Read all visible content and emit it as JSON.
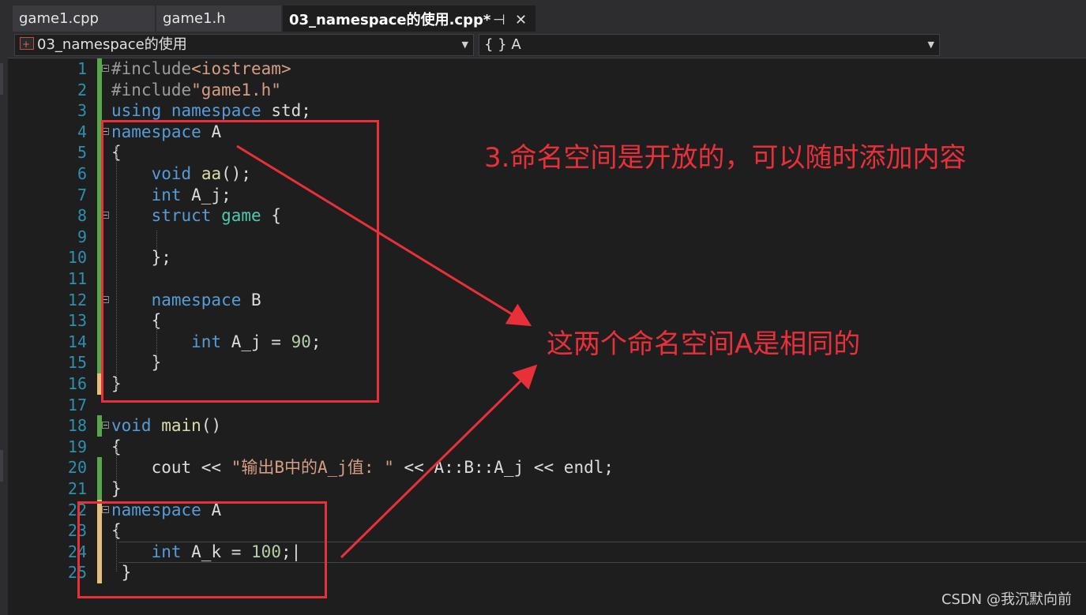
{
  "tabs": [
    {
      "label": "game1.cpp",
      "active": false
    },
    {
      "label": "game1.h",
      "active": false
    },
    {
      "label": "03_namespace的使用.cpp*",
      "active": true
    }
  ],
  "tab_icons": {
    "pin": "⊣",
    "close": "✕"
  },
  "nav": {
    "scope": "03_namespace的使用",
    "member": "{ } A"
  },
  "code_lines": [
    {
      "n": "1",
      "segments": [
        [
          "pp",
          "#include"
        ],
        [
          "str",
          "<iostream>"
        ]
      ]
    },
    {
      "n": "2",
      "segments": [
        [
          "pp",
          "#include"
        ],
        [
          "str",
          "\"game1.h\""
        ]
      ]
    },
    {
      "n": "3",
      "segments": [
        [
          "kw",
          "using"
        ],
        [
          "t",
          " "
        ],
        [
          "kw",
          "namespace"
        ],
        [
          "t",
          " std;"
        ]
      ]
    },
    {
      "n": "4",
      "segments": [
        [
          "kw",
          "namespace"
        ],
        [
          "t",
          " A"
        ]
      ]
    },
    {
      "n": "5",
      "segments": [
        [
          "t",
          "{"
        ]
      ]
    },
    {
      "n": "6",
      "segments": [
        [
          "t",
          "    "
        ],
        [
          "kw",
          "void"
        ],
        [
          "t",
          " "
        ],
        [
          "fn",
          "aa"
        ],
        [
          "t",
          "();"
        ]
      ]
    },
    {
      "n": "7",
      "segments": [
        [
          "t",
          "    "
        ],
        [
          "kw",
          "int"
        ],
        [
          "t",
          " A_j;"
        ]
      ]
    },
    {
      "n": "8",
      "segments": [
        [
          "t",
          "    "
        ],
        [
          "kw",
          "struct"
        ],
        [
          "t",
          " "
        ],
        [
          "ty",
          "game"
        ],
        [
          "t",
          " {"
        ]
      ]
    },
    {
      "n": "9",
      "segments": [
        [
          "t",
          ""
        ]
      ]
    },
    {
      "n": "10",
      "segments": [
        [
          "t",
          "    };"
        ]
      ]
    },
    {
      "n": "11",
      "segments": [
        [
          "t",
          ""
        ]
      ]
    },
    {
      "n": "12",
      "segments": [
        [
          "t",
          "    "
        ],
        [
          "kw",
          "namespace"
        ],
        [
          "t",
          " B"
        ]
      ]
    },
    {
      "n": "13",
      "segments": [
        [
          "t",
          "    {"
        ]
      ]
    },
    {
      "n": "14",
      "segments": [
        [
          "t",
          "        "
        ],
        [
          "kw",
          "int"
        ],
        [
          "t",
          " A_j = "
        ],
        [
          "num",
          "90"
        ],
        [
          "t",
          ";"
        ]
      ]
    },
    {
      "n": "15",
      "segments": [
        [
          "t",
          "    }"
        ]
      ]
    },
    {
      "n": "16",
      "segments": [
        [
          "t",
          "}"
        ]
      ]
    },
    {
      "n": "17",
      "segments": [
        [
          "t",
          ""
        ]
      ]
    },
    {
      "n": "18",
      "segments": [
        [
          "kw",
          "void"
        ],
        [
          "t",
          " "
        ],
        [
          "fn",
          "main"
        ],
        [
          "t",
          "()"
        ]
      ]
    },
    {
      "n": "19",
      "segments": [
        [
          "t",
          "{"
        ]
      ]
    },
    {
      "n": "20",
      "segments": [
        [
          "t",
          "    cout << "
        ],
        [
          "str",
          "\"输出B中的A_j值: \""
        ],
        [
          "t",
          " << A::B::A_j << endl;"
        ]
      ]
    },
    {
      "n": "21",
      "segments": [
        [
          "t",
          "}"
        ]
      ]
    },
    {
      "n": "22",
      "segments": [
        [
          "kw",
          "namespace"
        ],
        [
          "t",
          " A"
        ]
      ]
    },
    {
      "n": "23",
      "segments": [
        [
          "t",
          "{"
        ]
      ]
    },
    {
      "n": "24",
      "segments": [
        [
          "t",
          "    "
        ],
        [
          "kw",
          "int"
        ],
        [
          "t",
          " A_k = "
        ],
        [
          "num",
          "100"
        ],
        [
          "t",
          ";|"
        ]
      ]
    },
    {
      "n": "25",
      "segments": [
        [
          "t",
          " }"
        ]
      ]
    }
  ],
  "annotations": {
    "note1": "3.命名空间是开放的，可以随时添加内容",
    "note2": "这两个命名空间A是相同的"
  },
  "watermark": "CSDN @我沉默向前",
  "colors": {
    "annotation_red": "#e8303a",
    "keyword": "#569cd6",
    "type": "#4ec9b0",
    "string": "#d69d85"
  }
}
